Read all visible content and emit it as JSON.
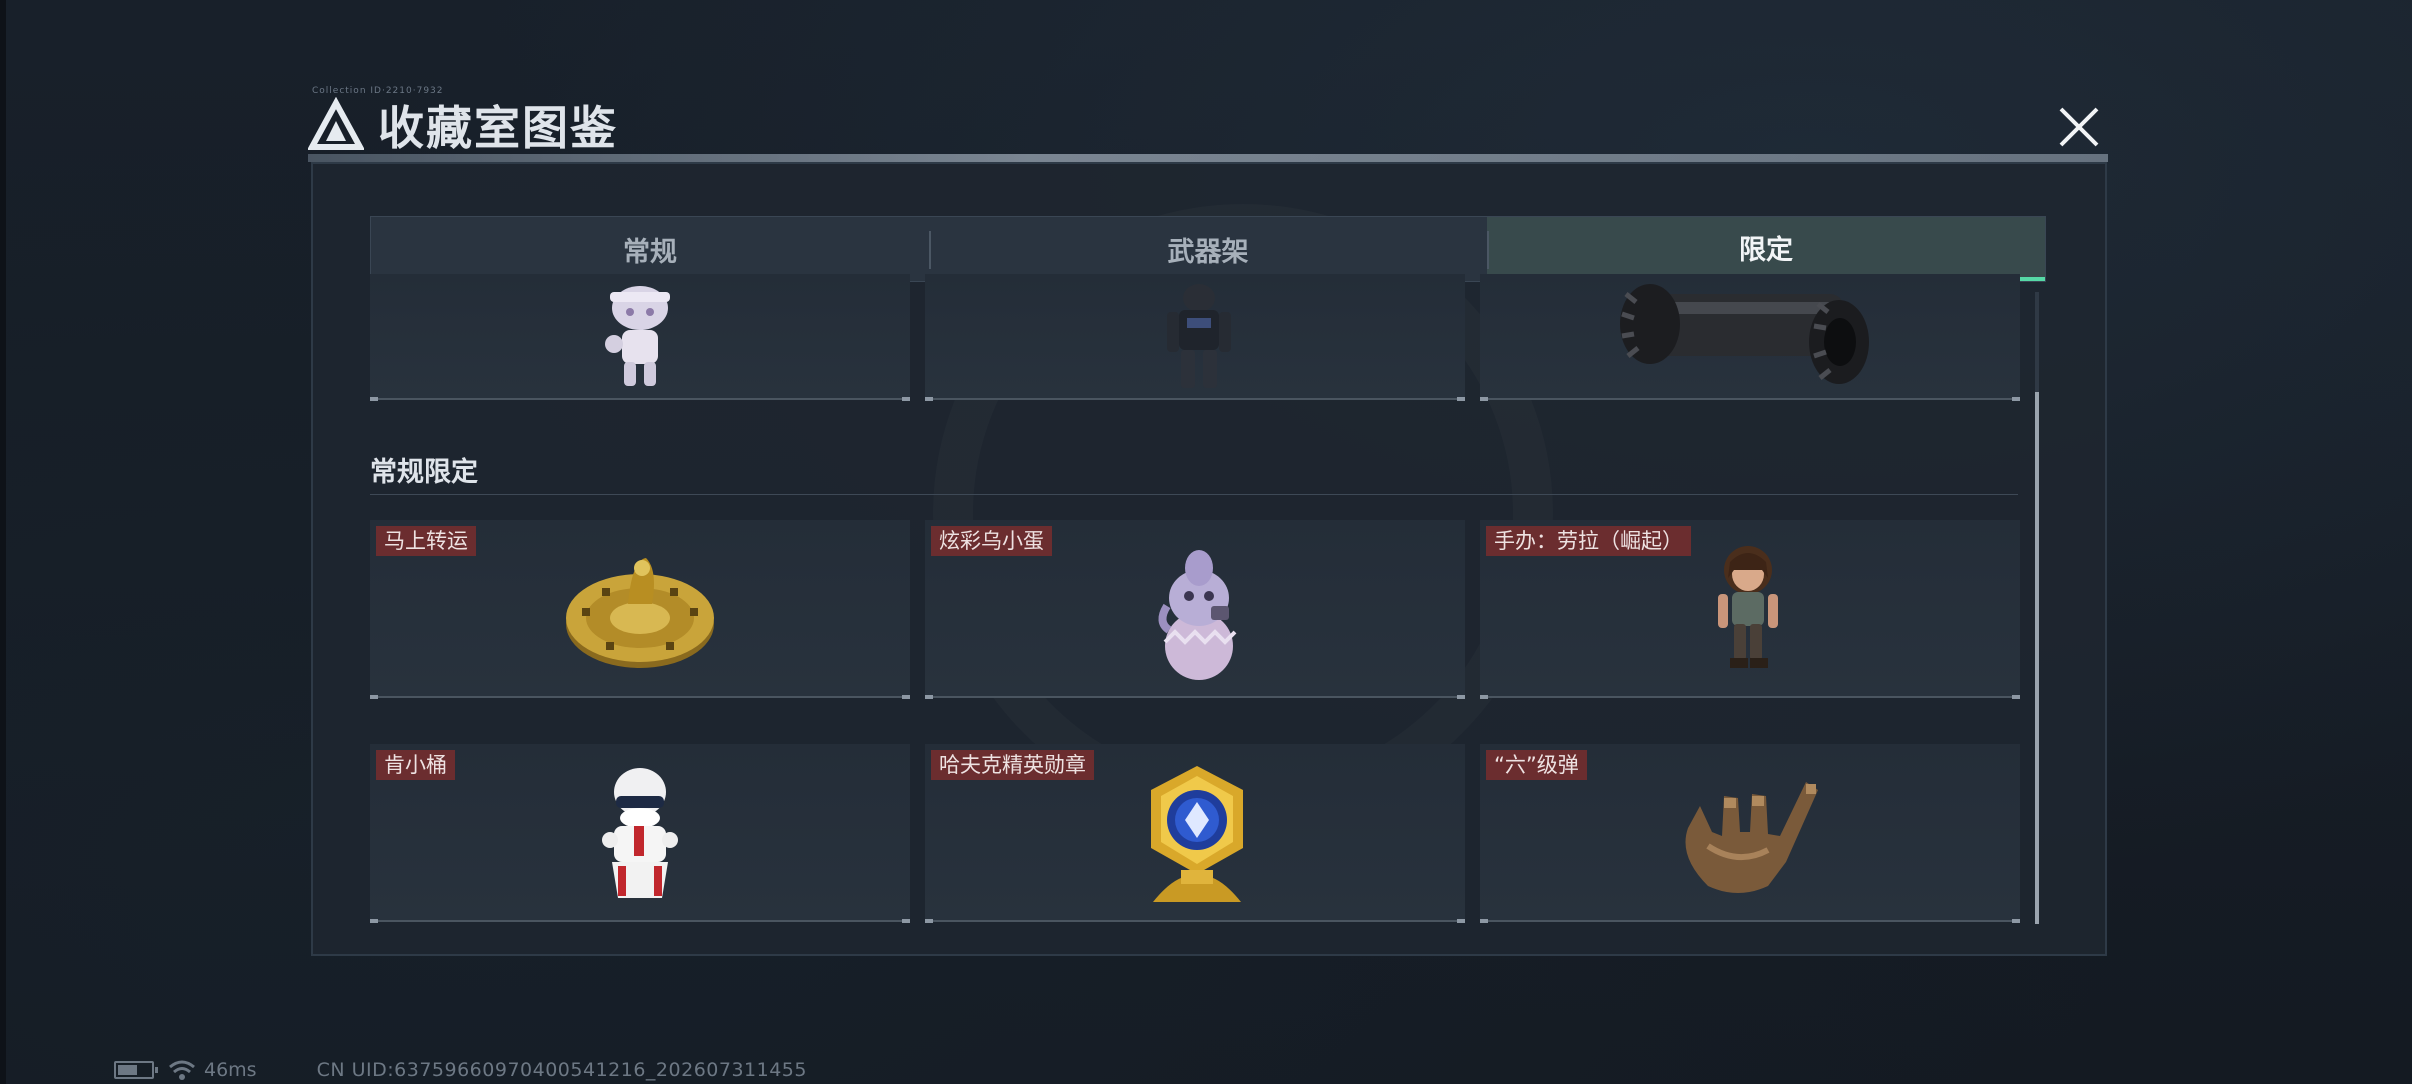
{
  "header": {
    "tiny_text": "Collection ID·2210·7932",
    "title": "收藏室图鉴",
    "close_icon": "close-x-icon"
  },
  "tabs": [
    {
      "label": "常规",
      "active": false
    },
    {
      "label": "武器架",
      "active": false
    },
    {
      "label": "限定",
      "active": true
    }
  ],
  "top_row": [
    {
      "name": "",
      "icon": "white-figurine"
    },
    {
      "name": "",
      "icon": "armored-soldier-figure"
    },
    {
      "name": "",
      "icon": "black-cylinder-barrel"
    }
  ],
  "section": {
    "title": "常规限定",
    "items": [
      {
        "label": "马上转运",
        "icon": "golden-horse-disc"
      },
      {
        "label": "炫彩乌小蛋",
        "icon": "bird-egg-figure"
      },
      {
        "label": "手办：劳拉（崛起）",
        "icon": "lara-figurine"
      },
      {
        "label": "肯小桶",
        "icon": "bucket-mascot-figure"
      },
      {
        "label": "哈夫克精英勋章",
        "icon": "gold-blue-medal"
      },
      {
        "label": "“六”级弹",
        "icon": "bronze-hand-sign"
      }
    ]
  },
  "status": {
    "battery_level": 0.6,
    "wifi_icon": "wifi-icon",
    "ping": "46ms",
    "uid": "CN UID:6375966097040054​1216_202607311455"
  },
  "colors": {
    "accent_green": "#56d9a6",
    "tag_red": "#6b2d2f",
    "panel_bg": "#1e2630"
  }
}
